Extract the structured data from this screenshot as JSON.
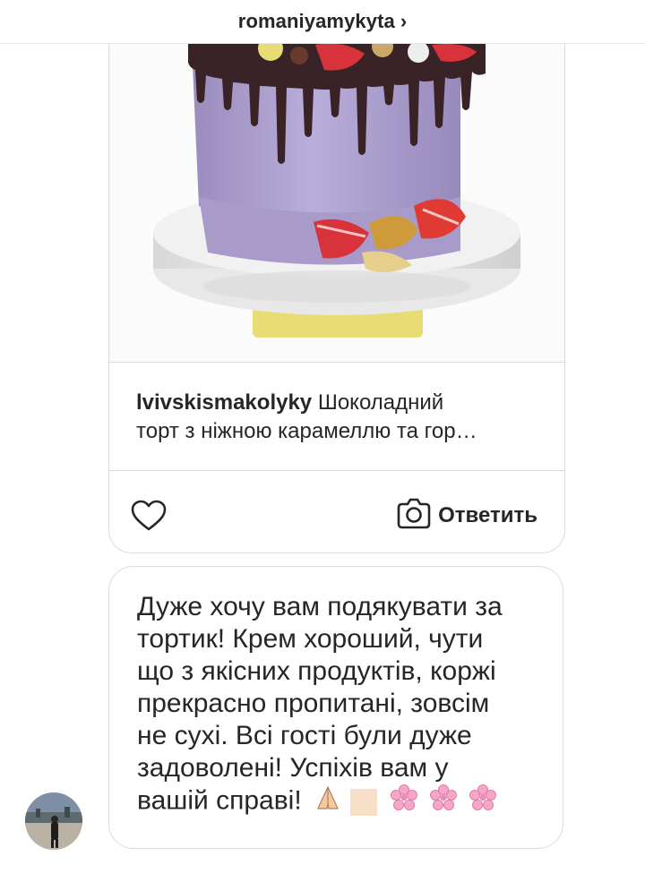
{
  "header": {
    "username": "romaniyamykyta",
    "chevron": "›"
  },
  "shared_post": {
    "author": "lvivskismakolyky",
    "caption_line1": "Шоколадний",
    "caption_line2": "торт з ніжною карамеллю та гор…",
    "reply_label": "Ответить",
    "image_alt": "purple cake with chocolate drip and strawberries"
  },
  "message": {
    "lines": [
      "Дуже хочу вам подякувати за",
      "тортик! Крем хороший, чути",
      "що з якісних продуктів, коржі",
      "прекрасно пропитані, зовсім",
      "не сухі. Всі гості були дуже",
      "задоволені! Успіхів вам у",
      "вашій справі!"
    ],
    "emojis": [
      "folded-hands-icon",
      "cherry-blossom-icon",
      "cherry-blossom-icon",
      "cherry-blossom-icon"
    ]
  },
  "colors": {
    "border": "#dbdbdb",
    "text": "#262626",
    "cake_purple": "#a99bc6",
    "chocolate": "#3a2326",
    "board_gold": "#e9dc74"
  }
}
